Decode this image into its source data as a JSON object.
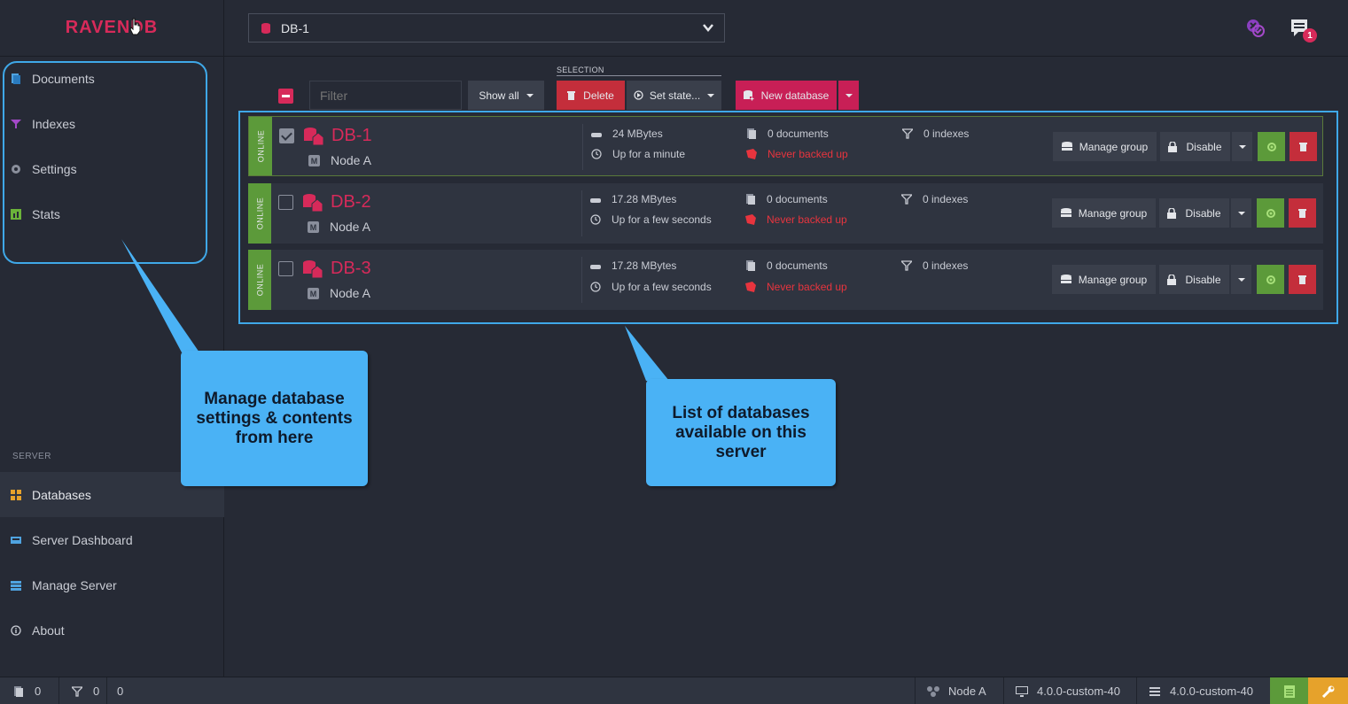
{
  "app": {
    "logo": "RAVENDB"
  },
  "sidebar": {
    "items": [
      {
        "label": "Documents"
      },
      {
        "label": "Indexes"
      },
      {
        "label": "Settings"
      },
      {
        "label": "Stats"
      }
    ],
    "server_label": "SERVER",
    "server_items": [
      {
        "label": "Databases"
      },
      {
        "label": "Server Dashboard"
      },
      {
        "label": "Manage Server"
      },
      {
        "label": "About"
      }
    ]
  },
  "header": {
    "selected_db": "DB-1",
    "notification_count": "1"
  },
  "toolbar": {
    "filter_placeholder": "Filter",
    "show_all": "Show all",
    "selection_label": "SELECTION",
    "delete": "Delete",
    "set_state": "Set state...",
    "new_database": "New database"
  },
  "databases": [
    {
      "status": "ONLINE",
      "name": "DB-1",
      "node": "Node A",
      "size": "24 MBytes",
      "uptime": "Up for a minute",
      "documents": "0 documents",
      "backup": "Never backed up",
      "indexes": "0 indexes",
      "manage_group": "Manage group",
      "disable": "Disable",
      "checked": true
    },
    {
      "status": "ONLINE",
      "name": "DB-2",
      "node": "Node A",
      "size": "17.28 MBytes",
      "uptime": "Up for a few seconds",
      "documents": "0 documents",
      "backup": "Never backed up",
      "indexes": "0 indexes",
      "manage_group": "Manage group",
      "disable": "Disable",
      "checked": false
    },
    {
      "status": "ONLINE",
      "name": "DB-3",
      "node": "Node A",
      "size": "17.28 MBytes",
      "uptime": "Up for a few seconds",
      "documents": "0 documents",
      "backup": "Never backed up",
      "indexes": "0 indexes",
      "manage_group": "Manage group",
      "disable": "Disable",
      "checked": false
    }
  ],
  "callouts": {
    "left": "Manage database settings & contents from here",
    "right": "List of databases available on this server"
  },
  "footer": {
    "docs_count": "0",
    "index_count": "0",
    "index_errors": "0",
    "node": "Node A",
    "client_version": "4.0.0-custom-40",
    "server_version": "4.0.0-custom-40"
  },
  "colors": {
    "accent": "#d72a5a",
    "online": "#5c9a3a",
    "callout": "#4ab2f5"
  }
}
